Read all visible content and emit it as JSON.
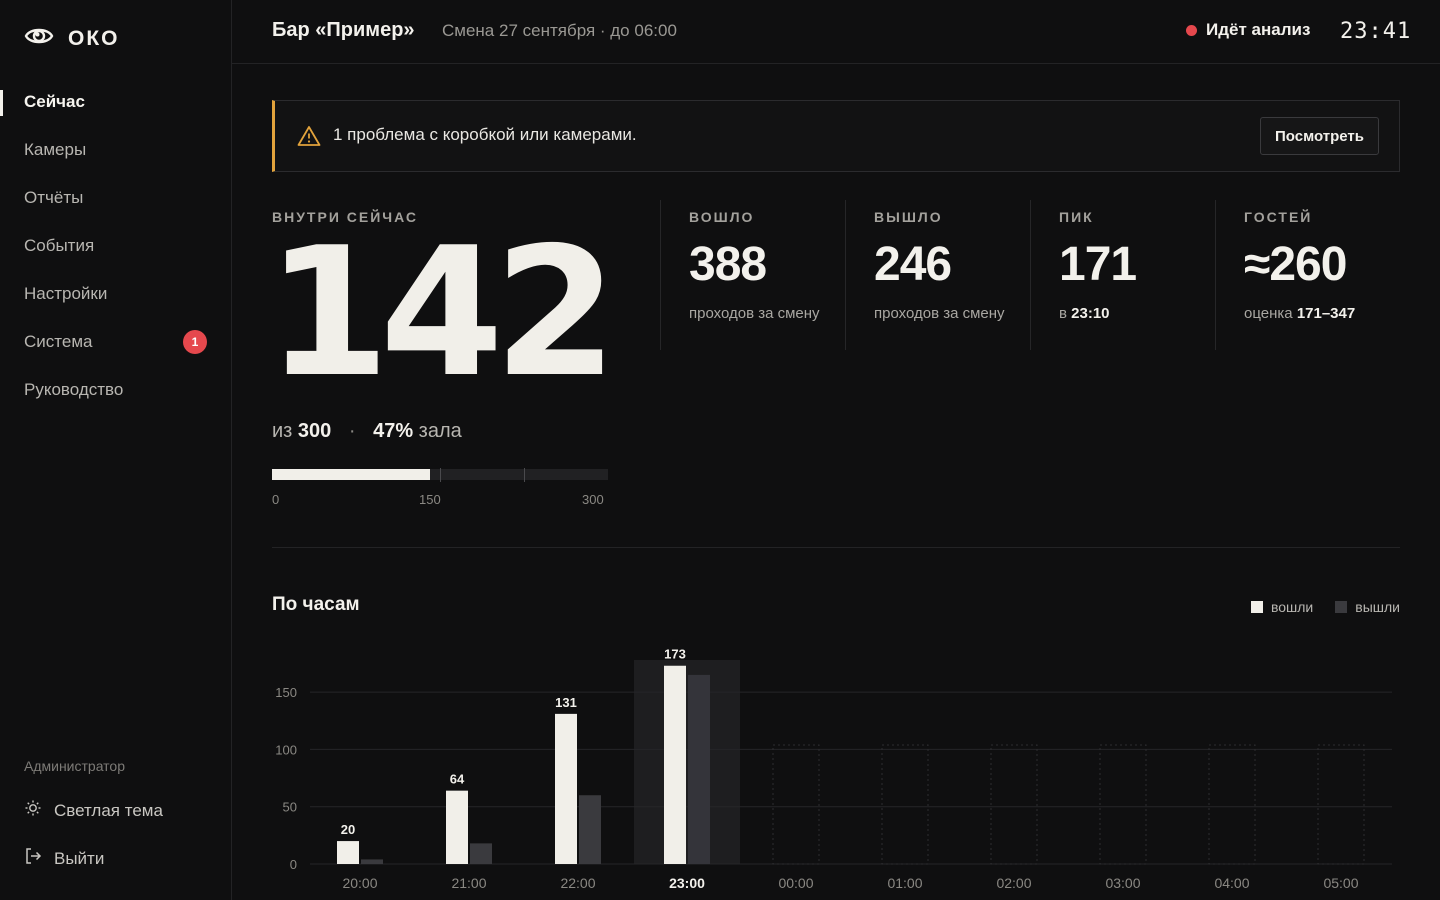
{
  "app": {
    "name": "ОКО"
  },
  "sidebar": {
    "items": [
      {
        "label": "Сейчас",
        "active": true
      },
      {
        "label": "Камеры"
      },
      {
        "label": "Отчёты"
      },
      {
        "label": "События"
      },
      {
        "label": "Настройки"
      },
      {
        "label": "Система",
        "badge": "1"
      },
      {
        "label": "Руководство"
      }
    ],
    "role": "Администратор",
    "theme_label": "Светлая тема",
    "logout_label": "Выйти"
  },
  "header": {
    "venue": "Бар «Пример»",
    "shift": "Смена 27 сентября · до 06:00",
    "status": "Идёт анализ",
    "time": "23:41"
  },
  "alert": {
    "text": "1 проблема с коробкой или камерами.",
    "button": "Посмотреть",
    "color": "#e2a33c"
  },
  "occupancy": {
    "label": "ВНУТРИ СЕЙЧАС",
    "value": "142",
    "prefix": "из",
    "capacity": "300",
    "sep": "·",
    "percent": "47%",
    "percent_suffix": "зала",
    "fraction": 0.47,
    "scale": [
      "0",
      "150",
      "300"
    ]
  },
  "stats": [
    {
      "label": "ВОШЛО",
      "value": "388",
      "sub": "проходов за смену"
    },
    {
      "label": "ВЫШЛО",
      "value": "246",
      "sub": "проходов за смену"
    },
    {
      "label": "ПИК",
      "value": "171",
      "sub_prefix": "в",
      "sub_bold": "23:10"
    },
    {
      "label": "ГОСТЕЙ",
      "value": "≈260",
      "sub_prefix": "оценка",
      "sub_bold": "171–347"
    }
  ],
  "chart_data": {
    "type": "bar",
    "title": "По часам",
    "categories": [
      "20:00",
      "21:00",
      "22:00",
      "23:00",
      "00:00",
      "01:00",
      "02:00",
      "03:00",
      "04:00",
      "05:00"
    ],
    "series": [
      {
        "name": "вошли",
        "values": [
          20,
          64,
          131,
          173,
          null,
          null,
          null,
          null,
          null,
          null
        ],
        "color": "#f1efe9"
      },
      {
        "name": "вышли",
        "values": [
          4,
          18,
          60,
          165,
          null,
          null,
          null,
          null,
          null,
          null
        ],
        "color": "#3a3a3e"
      }
    ],
    "data_labels": [
      "20",
      "64",
      "131",
      "173"
    ],
    "current": "23:00",
    "yticks": [
      "0",
      "50",
      "100",
      "150"
    ],
    "ylim": [
      0,
      175
    ],
    "grid": true,
    "legend": "top-right"
  }
}
